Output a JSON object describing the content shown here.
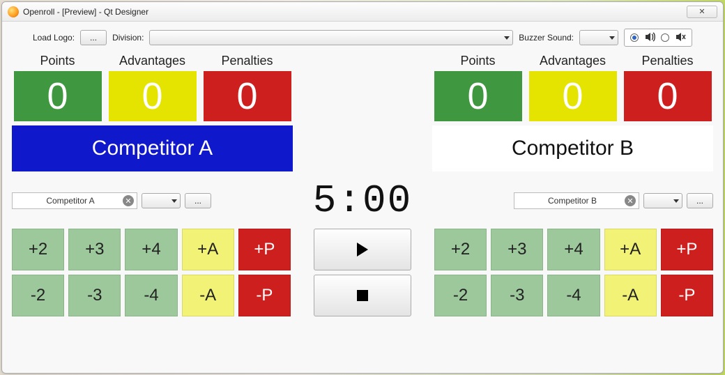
{
  "window": {
    "title": "Openroll - [Preview] - Qt Designer",
    "close_label": "✕"
  },
  "toolbar": {
    "load_logo_label": "Load Logo:",
    "load_logo_btn": "...",
    "division_label": "Division:",
    "buzzer_label": "Buzzer Sound:"
  },
  "headers": {
    "points": "Points",
    "advantages": "Advantages",
    "penalties": "Penalties"
  },
  "competitorA": {
    "points": "0",
    "advantages": "0",
    "penalties": "0",
    "display_name": "Competitor A",
    "input_value": "Competitor A"
  },
  "competitorB": {
    "points": "0",
    "advantages": "0",
    "penalties": "0",
    "display_name": "Competitor B",
    "input_value": "Competitor B"
  },
  "timer": "5:00",
  "browse_btn": "...",
  "buttons": {
    "p2": "+2",
    "p3": "+3",
    "p4": "+4",
    "pA": "+A",
    "pP": "+P",
    "m2": "-2",
    "m3": "-3",
    "m4": "-4",
    "mA": "-A",
    "mP": "-P"
  }
}
